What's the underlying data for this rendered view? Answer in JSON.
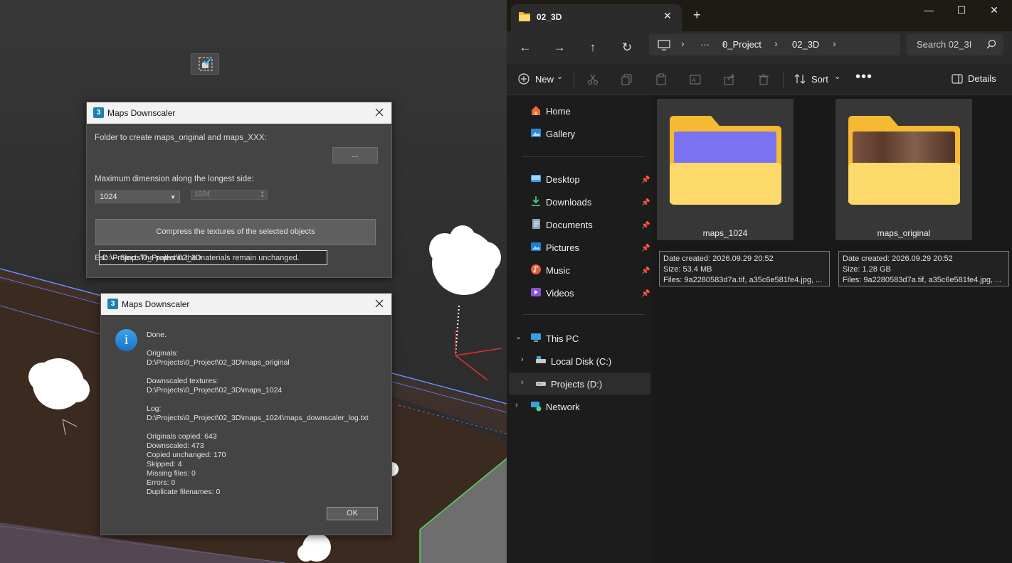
{
  "viewport": {
    "tool_icon": "selection-region-icon"
  },
  "dialog_settings": {
    "title": "Maps Downscaler",
    "app_icon_text": "3",
    "folder_label": "Folder to create maps_original and maps_XXX:",
    "folder_value": "D:\\Projects\\0_Project\\02_3D",
    "browse_label": "...",
    "max_dim_label": "Maximum dimension along the longest side:",
    "size_selected": "1024",
    "size_spinner": "1024",
    "compress_label": "Compress the textures of the selected objects",
    "hint": "Esc — Stop. The paths in the materials remain unchanged."
  },
  "dialog_result": {
    "title": "Maps Downscaler",
    "app_icon_text": "3",
    "info_glyph": "i",
    "done": "Done.",
    "originals_label": "Originals:",
    "originals_path": "D:\\Projects\\0_Project\\02_3D\\maps_original",
    "downscaled_label": "Downscaled textures:",
    "downscaled_path": "D:\\Projects\\0_Project\\02_3D\\maps_1024",
    "log_label": "Log:",
    "log_path": "D:\\Projects\\0_Project\\02_3D\\maps_1024\\maps_downscaler_log.txt",
    "stats": [
      "Originals copied: 643",
      "Downscaled: 473",
      "Copied unchanged: 170",
      "Skipped: 4",
      "Missing files: 0",
      "Errors: 0",
      "Duplicate filenames: 0"
    ],
    "ok_label": "OK"
  },
  "explorer": {
    "tab_title": "02_3D",
    "tab_close": "✕",
    "new_tab": "+",
    "window_controls": {
      "minimize": "—",
      "maximize": "☐",
      "close": "✕"
    },
    "nav_glyphs": {
      "back": "←",
      "forward": "→",
      "up": "↑",
      "refresh": "↻"
    },
    "breadcrumb": {
      "more": "···",
      "sep": "›",
      "items": [
        "0_Project",
        "02_3D"
      ]
    },
    "search_placeholder": "Search 02_3I",
    "toolbar": {
      "new_label": "New",
      "sort_label": "Sort",
      "more_label": "•••",
      "details_label": "Details",
      "caret": "⌄"
    },
    "nav": {
      "home": "Home",
      "gallery": "Gallery",
      "desktop": "Desktop",
      "downloads": "Downloads",
      "documents": "Documents",
      "pictures": "Pictures",
      "music": "Music",
      "videos": "Videos",
      "this_pc": "This PC",
      "local_disk": "Local Disk (C:)",
      "projects": "Projects (D:)",
      "network": "Network",
      "pin_glyph": "📌",
      "chev_down": "⌄",
      "chev_right": "›"
    },
    "folders": [
      {
        "name": "maps_1024",
        "date": "Date created: 2026.09.29 20:52",
        "size": "Size: 53.4 MB",
        "files": "Files: 9a2280583d7a.tif, a35c6e581fe4.jpg, ...",
        "preview_color": "#7b72f2"
      },
      {
        "name": "maps_original",
        "date": "Date created: 2026.09.29 20:52",
        "size": "Size: 1.28 GB",
        "files": "Files: 9a2280583d7a.tif, a35c6e581fe4.jpg, ...",
        "preview_color": "#6b4a3a"
      }
    ],
    "colors": {
      "folder_back": "#f5b932",
      "folder_front": "#fcd96a",
      "accent": "#4cc2ff"
    }
  }
}
